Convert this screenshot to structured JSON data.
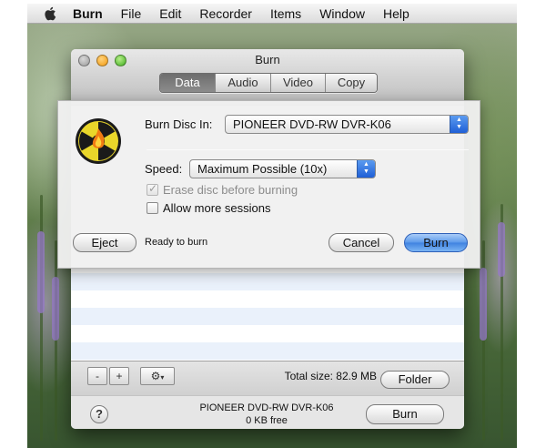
{
  "menubar": {
    "app_name": "Burn",
    "menus": [
      "File",
      "Edit",
      "Recorder",
      "Items",
      "Window",
      "Help"
    ]
  },
  "window": {
    "title": "Burn",
    "tabs": [
      {
        "label": "Data",
        "active": true
      },
      {
        "label": "Audio",
        "active": false
      },
      {
        "label": "Video",
        "active": false
      },
      {
        "label": "Copy",
        "active": false
      }
    ],
    "footer": {
      "remove_label": "-",
      "add_label": "+",
      "action_icon": "gear-icon",
      "total_size": "Total size: 82.9 MB",
      "folder_label": "Folder"
    },
    "bottom": {
      "help_label": "?",
      "device_name": "PIONEER DVD-RW DVR-K06",
      "device_free": "0 KB free",
      "burn_label": "Burn"
    }
  },
  "sheet": {
    "burn_disc_label": "Burn Disc In:",
    "burn_disc_value": "PIONEER DVD-RW DVR-K06",
    "speed_label": "Speed:",
    "speed_value": "Maximum Possible (10x)",
    "erase_label": "Erase disc before burning",
    "erase_checked": true,
    "erase_enabled": false,
    "sessions_label": "Allow more sessions",
    "sessions_checked": false,
    "eject_label": "Eject",
    "status": "Ready to burn",
    "cancel_label": "Cancel",
    "burn_label": "Burn",
    "accent": "#3f82e0"
  }
}
